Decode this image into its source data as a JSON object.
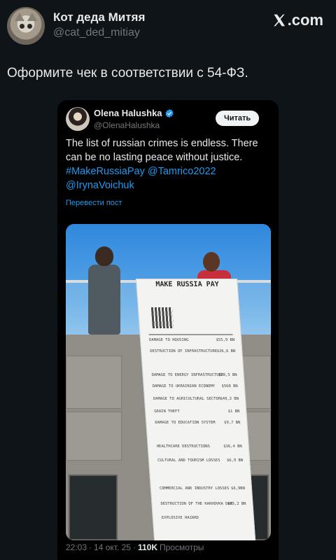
{
  "outer_post": {
    "author_name": "Кот деда Митяя",
    "author_handle": "@cat_ded_mitiay",
    "brand_label": ".com",
    "text": "Оформите чек в соответствии с 54-ФЗ."
  },
  "embedded_post": {
    "author_name": "Olena Halushka",
    "author_handle": "@OlenaHalushka",
    "read_button": "Читать",
    "text_plain": "The list of russian crimes is endless. There can be no lasting peace without justice.",
    "hashtag": "#MakeRussiaPay",
    "mention_1": "@Tamrico2022",
    "mention_2": "@IrynaVoichuk",
    "translate_link": "Перевести пост",
    "photo_receipt": {
      "title": "MAKE RUSSIA PAY",
      "items": [
        {
          "label": "DAMAGE TO HOUSING",
          "amount": "$55,9 BN"
        },
        {
          "label": "DESTRUCTION OF INFRASTRUCTURE",
          "amount": "$36,6 BN"
        },
        {
          "label": "DAMAGE TO ENERGY INFRASTRUCTURE",
          "amount": "$20,5 BN"
        },
        {
          "label": "DAMAGE TO UKRAINIAN ECONOMY",
          "amount": "$560 BN"
        },
        {
          "label": "DAMAGE TO AGRICULTURAL SECTOR",
          "amount": "$40,2 BN"
        },
        {
          "label": "GRAIN THEFT",
          "amount": "$1 BN"
        },
        {
          "label": "DAMAGE TO EDUCATION SYSTEM",
          "amount": "$9,7 BN"
        },
        {
          "label": "HEALTHCARE DESTRUCTIONS",
          "amount": "$36,4 BN"
        },
        {
          "label": "CULTURAL AND TOURISM LOSSES",
          "amount": "$6,9 BN"
        },
        {
          "label": "COMMERCIAL AND INDUSTRY LOSSES",
          "amount": "$6,9BN"
        },
        {
          "label": "DESTRUCTION OF THE KAKHOVKA DAM",
          "amount": "$23,2 BN"
        },
        {
          "label": "EXPLOSIVE HAZARD",
          "amount": ""
        }
      ]
    },
    "time": "22:03",
    "date": "14 окт. 25",
    "views_count": "110K",
    "views_label": "Просмотры",
    "separator": "·"
  },
  "colors": {
    "background": "#0f1419",
    "link": "#1d9bf0",
    "muted": "#71767b"
  },
  "icons": [
    "x-logo-icon",
    "verified-badge-icon"
  ]
}
